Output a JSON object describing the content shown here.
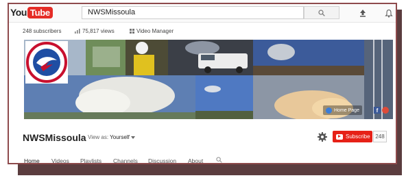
{
  "header": {
    "logo_you": "You",
    "logo_tube": "Tube",
    "search_value": "NWSMissoula"
  },
  "stats": {
    "subscribers": "248 subscribers",
    "views": "75,817 views",
    "video_manager": "Video Manager"
  },
  "banner": {
    "home_page": "Home Page",
    "facebook": "f"
  },
  "channel": {
    "name": "NWSMissoula",
    "view_as_label": "View as:",
    "view_as_value": "Yourself",
    "subscribe_label": "Subscribe",
    "subscriber_count": "248"
  },
  "tabs": [
    "Home",
    "Videos",
    "Playlists",
    "Channels",
    "Discussion",
    "About"
  ],
  "colors": {
    "brand_red": "#e52d27",
    "subscribe_red": "#e62117",
    "frame_border": "#8e4a4c",
    "frame_shadow": "#5b3d3f"
  },
  "icons": [
    "search-icon",
    "upload-icon",
    "bell-icon",
    "bar-chart-icon",
    "grid-icon",
    "gear-icon",
    "chevron-down-icon",
    "globe-icon",
    "facebook-icon",
    "google-plus-icon",
    "nws-logo"
  ]
}
